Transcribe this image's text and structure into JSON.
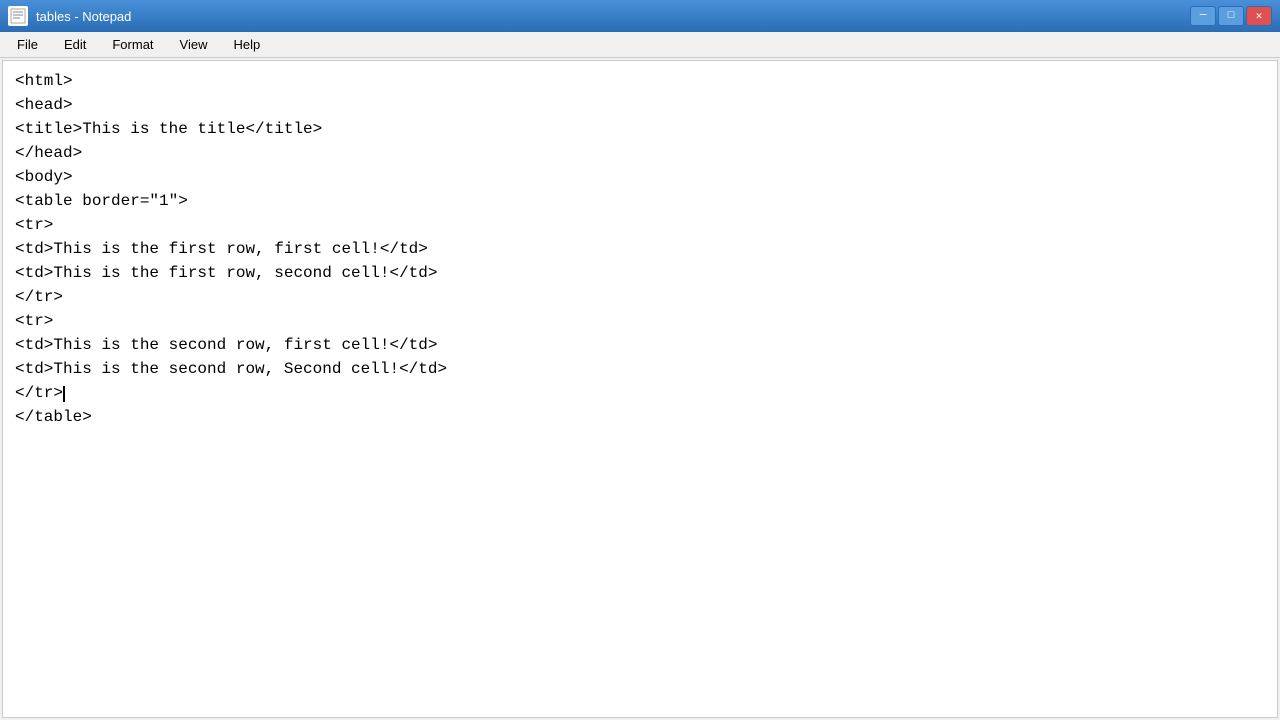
{
  "titleBar": {
    "icon": "📄",
    "title": "tables - Notepad",
    "minimize": "─",
    "maximize": "□",
    "close": "✕"
  },
  "menuBar": {
    "items": [
      {
        "id": "file",
        "label": "File"
      },
      {
        "id": "edit",
        "label": "Edit"
      },
      {
        "id": "format",
        "label": "Format"
      },
      {
        "id": "view",
        "label": "View"
      },
      {
        "id": "help",
        "label": "Help"
      }
    ]
  },
  "editor": {
    "lines": [
      "<html>",
      "<head>",
      "<title>This is the title</title>",
      "</head>",
      "<body>",
      "<table border=\"1\">",
      "<tr>",
      "<td>This is the first row, first cell!</td>",
      "<td>This is the first row, second cell!</td>",
      "</tr>",
      "<tr>",
      "<td>This is the second row, first cell!</td>",
      "<td>This is the second row, Second cell!</td>",
      "</tr>",
      "</table>"
    ]
  }
}
